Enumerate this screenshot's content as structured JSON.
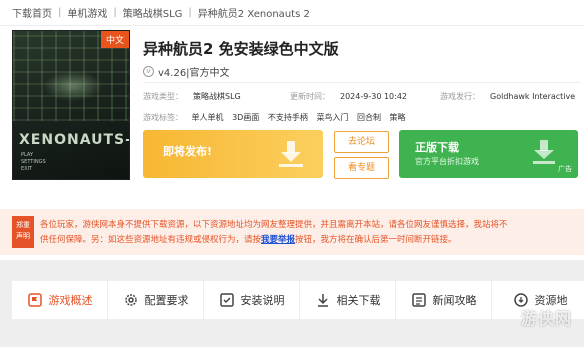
{
  "breadcrumb": [
    "下载首页",
    "单机游戏",
    "策略战棋SLG",
    "异种航员2 Xenonauts 2"
  ],
  "cover": {
    "badge": "中文",
    "logo_main": "XENONAUTS",
    "logo_sub": "-2",
    "menu": [
      "PLAY",
      "SETTINGS",
      "EXIT"
    ]
  },
  "game": {
    "title": "异种航员2 免安装绿色中文版",
    "version": "v4.26|官方中文",
    "type_label": "游戏类型：",
    "type": "策略战棋SLG",
    "update_label": "更新时间：",
    "update": "2024-9-30 10:42",
    "publisher_label": "游戏发行：",
    "publisher": "Goldhawk Interactive",
    "tags_label": "游戏标签：",
    "tags": [
      "单人单机",
      "3D画面",
      "不支持手柄",
      "菜鸟入门",
      "回合制",
      "策略"
    ]
  },
  "buttons": {
    "soon": "即将发布!",
    "forum": "去论坛",
    "topic": "看专题",
    "official_title": "正版下载",
    "official_sub": "官方平台折扣游戏",
    "ad": "广告"
  },
  "notice": {
    "label_line1": "郑重",
    "label_line2": "声明",
    "line1": "各位玩家，游侠网本身不提供下载资源，以下资源地址均为网友整理提供，并且需离开本站，请各位网友谨慎选择，我站将不",
    "line2_a": "供任何保障。另：如这些资源地址有违规或侵权行为，请按",
    "line2_link": "我要举报",
    "line2_b": "按钮，我方将在确认后第一时间断开链接。"
  },
  "tabs": [
    {
      "label": "游戏概述",
      "icon": "flag-icon"
    },
    {
      "label": "配置要求",
      "icon": "gear-icon"
    },
    {
      "label": "安装说明",
      "icon": "install-icon"
    },
    {
      "label": "相关下载",
      "icon": "download-icon"
    },
    {
      "label": "新闻攻略",
      "icon": "news-icon"
    },
    {
      "label": "资源地",
      "icon": "resource-icon"
    }
  ],
  "watermark": "游侠网",
  "colors": {
    "accent": "#e55428",
    "soon": "#f7b733",
    "official": "#3fb34f",
    "link": "#1a4fd6"
  }
}
